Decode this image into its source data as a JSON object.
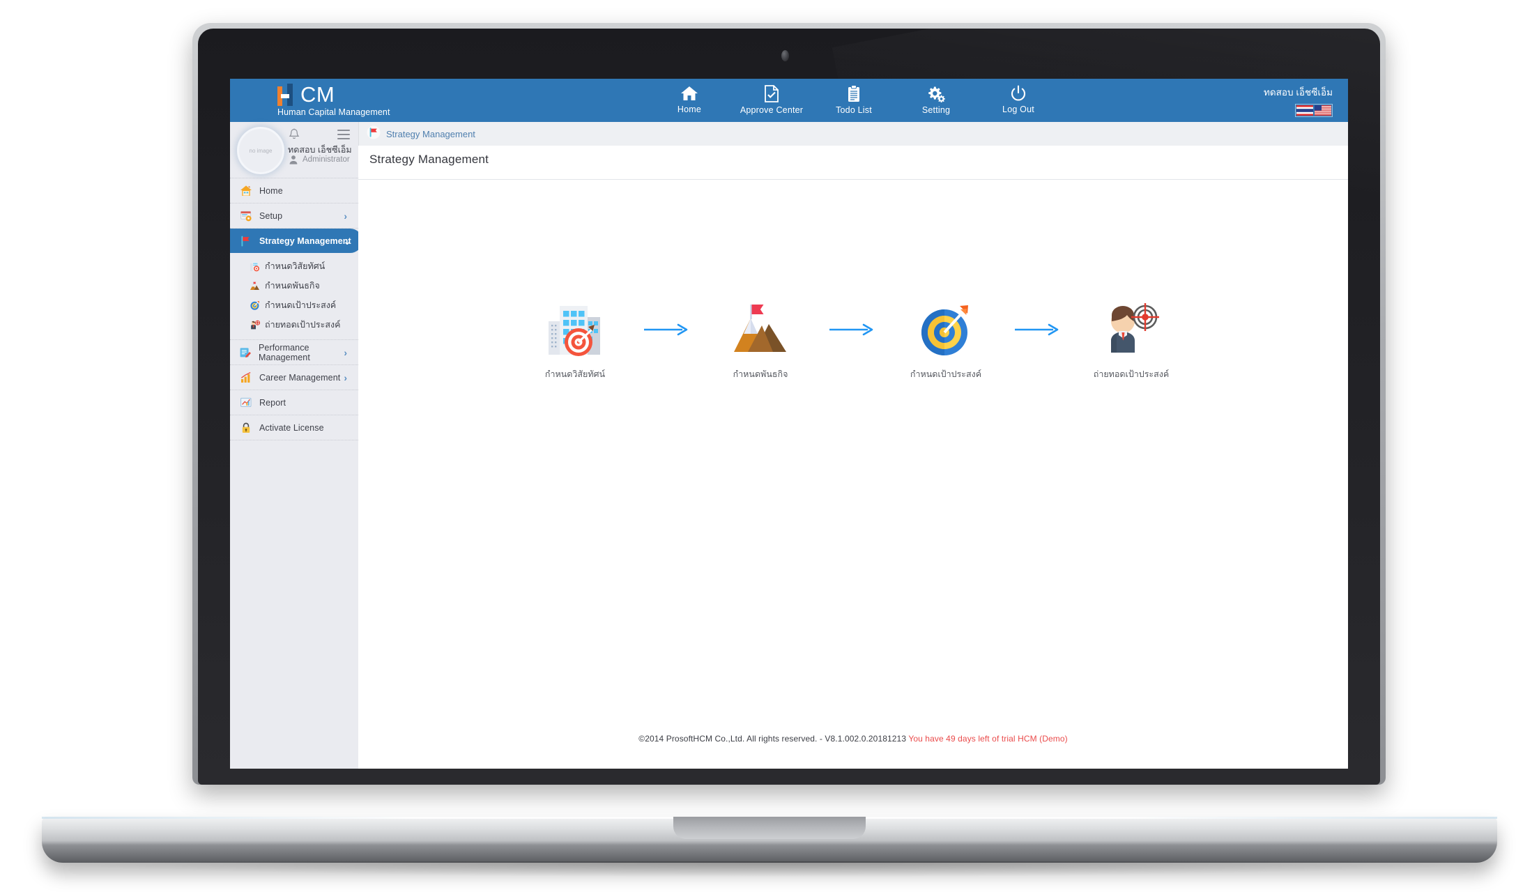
{
  "header": {
    "brand": {
      "mark": "h",
      "name": "CM",
      "tagline": "Human Capital Management"
    },
    "nav": [
      {
        "label": "Home",
        "icon": "home-icon"
      },
      {
        "label": "Approve Center",
        "icon": "document-check-icon"
      },
      {
        "label": "Todo List",
        "icon": "clipboard-icon"
      },
      {
        "label": "Setting",
        "icon": "gears-icon"
      },
      {
        "label": "Log Out",
        "icon": "power-icon"
      }
    ],
    "user_name": "ทดสอบ เอ็ชซีเอ็ม",
    "languages": [
      "flag-thailand",
      "flag-usa"
    ]
  },
  "breadcrumb": {
    "icon": "red-flag-icon",
    "text": "Strategy Management"
  },
  "sidebar": {
    "profile": {
      "avatar_placeholder": "no image",
      "name": "ทดสอบ เอ็ชซีเอ็ม",
      "role": "Administrator"
    },
    "items": [
      {
        "label": "Home",
        "icon": "house-icon",
        "chevron": "",
        "active": false
      },
      {
        "label": "Setup",
        "icon": "setup-gear-icon",
        "chevron": "›",
        "active": false
      },
      {
        "label": "Strategy Management",
        "icon": "red-flag-icon",
        "chevron": "⌄",
        "active": true
      },
      {
        "label": "Performance Management",
        "icon": "performance-icon",
        "chevron": "›",
        "active": false
      },
      {
        "label": "Career Management",
        "icon": "bar-chart-icon",
        "chevron": "›",
        "active": false
      },
      {
        "label": "Report",
        "icon": "report-icon",
        "chevron": "",
        "active": false
      },
      {
        "label": "Activate License",
        "icon": "padlock-icon",
        "chevron": "",
        "active": false
      }
    ],
    "submenu": [
      {
        "label": "กำหนดวิสัยทัศน์",
        "icon": "vision-building-icon"
      },
      {
        "label": "กำหนดพันธกิจ",
        "icon": "mission-mountain-icon"
      },
      {
        "label": "กำหนดเป้าประสงค์",
        "icon": "objective-target-icon"
      },
      {
        "label": "ถ่ายทอดเป้าประสงค์",
        "icon": "cascade-person-icon"
      }
    ]
  },
  "main": {
    "title": "Strategy Management",
    "flow": [
      {
        "label": "กำหนดวิสัยทัศน์",
        "icon": "vision-building-target-icon"
      },
      {
        "label": "กำหนดพันธกิจ",
        "icon": "mission-mountain-flag-icon"
      },
      {
        "label": "กำหนดเป้าประสงค์",
        "icon": "objective-dartboard-icon"
      },
      {
        "label": "ถ่ายทอดเป้าประสงค์",
        "icon": "cascade-person-target-icon"
      }
    ],
    "arrow_count": 3
  },
  "footer": {
    "copyright": "©2014 ProsoftHCM Co.,Ltd. All rights reserved.  -  V8.1.002.0.20181213 ",
    "trial": "You have 49 days left of trial HCM (Demo)"
  },
  "colors": {
    "header_blue": "#2f77b5",
    "sidebar_bg": "#eaebf0",
    "breadcrumb_link": "#4f7fae",
    "trial_red": "#ea4b4b",
    "arrow_blue": "#2196f3"
  }
}
